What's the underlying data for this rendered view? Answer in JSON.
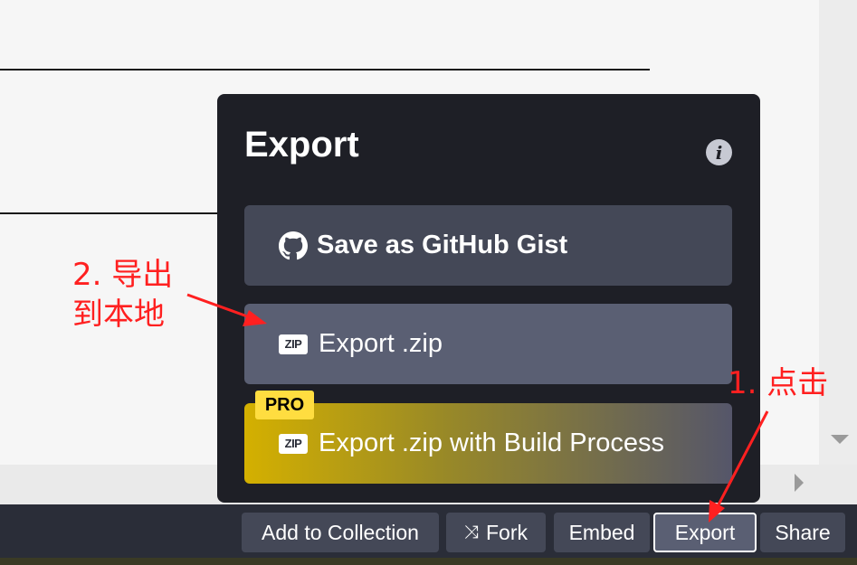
{
  "export_panel": {
    "title": "Export",
    "info_icon": "info-icon",
    "options": {
      "gist": {
        "label": "Save as GitHub Gist",
        "icon": "github-icon"
      },
      "zip": {
        "label": "Export .zip",
        "icon": "zip-icon",
        "icon_text": "ZIP"
      },
      "build": {
        "label": "Export .zip with Build Process",
        "icon": "zip-icon",
        "icon_text": "ZIP",
        "badge": "PRO"
      }
    }
  },
  "footer": {
    "add_to_collection": "Add to Collection",
    "fork": "Fork",
    "embed": "Embed",
    "export": "Export",
    "share": "Share"
  },
  "annotations": {
    "step1": "1. 点击",
    "step2_line1": "2. 导出",
    "step2_line2": "到本地"
  },
  "colors": {
    "panel_bg": "#1e1f26",
    "button_bg": "#444857",
    "highlight": "#5a5f73",
    "pro_badge": "#ffdd40",
    "annotation": "#ff2020"
  }
}
